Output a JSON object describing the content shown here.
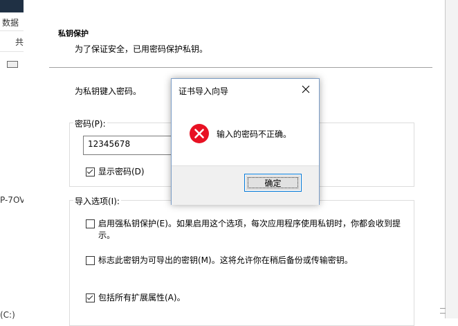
{
  "background_app": {
    "tab_label": "数据",
    "share_label": "共",
    "host_fragment": "P-7OV",
    "drive_fragment": "(C:)"
  },
  "wizard": {
    "section_title": "私钥保护",
    "section_description": "为了保证安全，已用密码保护私钥。",
    "password_prompt": "为私钥键入密码。",
    "password_group_label": "密码(P):",
    "password_value": "12345678",
    "show_password_label": "显示密码(D)",
    "show_password_checked": true,
    "import_options_label": "导入选项(I):",
    "options": [
      {
        "label": "启用强私钥保护(E)。如果启用这个选项，每次应用程序使用私钥时，你都会收到提",
        "label_line2": "示。",
        "checked": false
      },
      {
        "label": "标志此密钥为可导出的密钥(M)。这将允许你在稍后备份或传输密钥。",
        "checked": false
      },
      {
        "label": "包括所有扩展属性(A)。",
        "checked": true
      }
    ]
  },
  "dialog": {
    "title": "证书导入向导",
    "message": "输入的密码不正确。",
    "ok_label": "确定",
    "icon": "error-icon",
    "colors": {
      "error_red": "#e81123",
      "button_border": "#0078d7"
    }
  }
}
